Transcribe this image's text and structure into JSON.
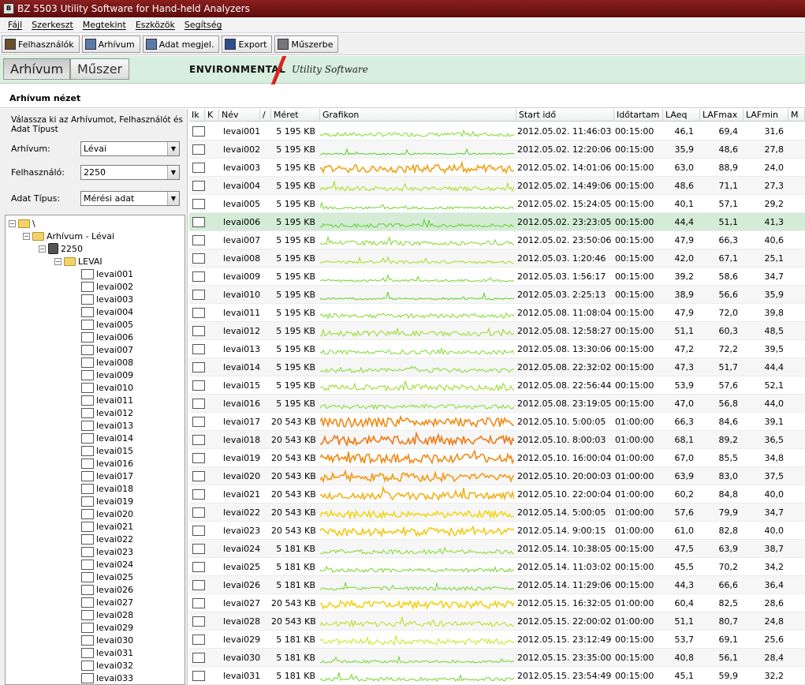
{
  "window": {
    "title": "BZ 5503 Utility Software for Hand-held Analyzers"
  },
  "menu": [
    "Fájl",
    "Szerkeszt",
    "Megtekint",
    "Eszközök",
    "Segítség"
  ],
  "toolbar": {
    "users": "Felhasználók",
    "archive": "Arhívum",
    "view_data": "Adat megjel.",
    "export": "Export",
    "to_device": "Műszerbe"
  },
  "header": {
    "tab_archive": "Arhívum",
    "tab_device": "Műszer",
    "brand": "ENVIRONMENTAL",
    "brand_sub": "Utility Software"
  },
  "section": {
    "title": "Arhívum nézet"
  },
  "left": {
    "instructions": "Válassza ki az Arhívumot, Felhasználót és Adat Típust",
    "archive_label": "Arhívum:",
    "archive_value": "Lévai",
    "user_label": "Felhasználó:",
    "user_value": "2250",
    "type_label": "Adat Típus:",
    "type_value": "Mérési adat"
  },
  "tree": {
    "root": "\\",
    "archive": "Arhívum - Lévai",
    "user": "2250",
    "folder": "LEVAI",
    "items": [
      "levai001",
      "levai002",
      "levai003",
      "levai004",
      "levai005",
      "levai006",
      "levai007",
      "levai008",
      "levai009",
      "levai010",
      "levai011",
      "levai012",
      "levai013",
      "levai014",
      "levai015",
      "levai016",
      "levai017",
      "levai018",
      "levai019",
      "levai020",
      "levai021",
      "levai022",
      "levai023",
      "levai024",
      "levai025",
      "levai026",
      "levai027",
      "levai028",
      "levai029",
      "levai030",
      "levai031",
      "levai032",
      "levai033"
    ]
  },
  "grid": {
    "columns": [
      "Ik",
      "K",
      "Név",
      "/",
      "Méret",
      "Grafikon",
      "Start idő",
      "Időtartam",
      "LAeq",
      "LAFmax",
      "LAFmin",
      "M"
    ],
    "selected_row": 5,
    "rows": [
      {
        "name": "levai001",
        "size": "5 195 KB",
        "start": "2012.05.02. 11:46:03",
        "duration": "00:15:00",
        "laeq": "46,1",
        "lafmax": "69,4",
        "lafmin": "31,6",
        "color": "#7bdc2a"
      },
      {
        "name": "levai002",
        "size": "5 195 KB",
        "start": "2012.05.02. 12:20:06",
        "duration": "00:15:00",
        "laeq": "35,9",
        "lafmax": "48,6",
        "lafmin": "27,8",
        "color": "#4fcf2a"
      },
      {
        "name": "levai003",
        "size": "5 195 KB",
        "start": "2012.05.02. 14:01:06",
        "duration": "00:15:00",
        "laeq": "63,0",
        "lafmax": "88,9",
        "lafmin": "24,0",
        "color": "#f0a21a"
      },
      {
        "name": "levai004",
        "size": "5 195 KB",
        "start": "2012.05.02. 14:49:06",
        "duration": "00:15:00",
        "laeq": "48,6",
        "lafmax": "71,1",
        "lafmin": "27,3",
        "color": "#a5dd1e"
      },
      {
        "name": "levai005",
        "size": "5 195 KB",
        "start": "2012.05.02. 15:24:05",
        "duration": "00:15:00",
        "laeq": "40,1",
        "lafmax": "57,1",
        "lafmin": "29,2",
        "color": "#6fd52a"
      },
      {
        "name": "levai006",
        "size": "5 195 KB",
        "start": "2012.05.02. 23:23:05",
        "duration": "00:15:00",
        "laeq": "44,4",
        "lafmax": "51,1",
        "lafmin": "41,3",
        "color": "#5fd02a"
      },
      {
        "name": "levai007",
        "size": "5 195 KB",
        "start": "2012.05.02. 23:50:06",
        "duration": "00:15:00",
        "laeq": "47,9",
        "lafmax": "66,3",
        "lafmin": "40,6",
        "color": "#7bdc2a"
      },
      {
        "name": "levai008",
        "size": "5 195 KB",
        "start": "2012.05.03. 1:20:46",
        "duration": "00:15:00",
        "laeq": "42,0",
        "lafmax": "67,1",
        "lafmin": "25,1",
        "color": "#a5dd1e"
      },
      {
        "name": "levai009",
        "size": "5 195 KB",
        "start": "2012.05.03. 1:56:17",
        "duration": "00:15:00",
        "laeq": "39,2",
        "lafmax": "58,6",
        "lafmin": "34,7",
        "color": "#6fd52a"
      },
      {
        "name": "levai010",
        "size": "5 195 KB",
        "start": "2012.05.03. 2:25:13",
        "duration": "00:15:00",
        "laeq": "38,9",
        "lafmax": "56,6",
        "lafmin": "35,9",
        "color": "#5fd02a"
      },
      {
        "name": "levai011",
        "size": "5 195 KB",
        "start": "2012.05.08. 11:08:04",
        "duration": "00:15:00",
        "laeq": "47,9",
        "lafmax": "72,0",
        "lafmin": "39,8",
        "color": "#7bdc2a"
      },
      {
        "name": "levai012",
        "size": "5 195 KB",
        "start": "2012.05.08. 12:58:27",
        "duration": "00:15:00",
        "laeq": "51,1",
        "lafmax": "60,3",
        "lafmin": "48,5",
        "color": "#8fdb22"
      },
      {
        "name": "levai013",
        "size": "5 195 KB",
        "start": "2012.05.08. 13:30:06",
        "duration": "00:15:00",
        "laeq": "47,2",
        "lafmax": "72,2",
        "lafmin": "39,5",
        "color": "#7bdc2a"
      },
      {
        "name": "levai014",
        "size": "5 195 KB",
        "start": "2012.05.08. 22:32:02",
        "duration": "00:15:00",
        "laeq": "47,3",
        "lafmax": "51,7",
        "lafmin": "44,4",
        "color": "#7bdc2a"
      },
      {
        "name": "levai015",
        "size": "5 195 KB",
        "start": "2012.05.08. 22:56:44",
        "duration": "00:15:00",
        "laeq": "53,9",
        "lafmax": "57,6",
        "lafmin": "52,1",
        "color": "#8fdb22"
      },
      {
        "name": "levai016",
        "size": "5 195 KB",
        "start": "2012.05.08. 23:19:05",
        "duration": "00:15:00",
        "laeq": "47,0",
        "lafmax": "56,8",
        "lafmin": "44,0",
        "color": "#7bdc2a"
      },
      {
        "name": "levai017",
        "size": "20 543 KB",
        "start": "2012.05.10. 5:00:05",
        "duration": "01:00:00",
        "laeq": "66,3",
        "lafmax": "84,6",
        "lafmin": "39,1",
        "color": "#f08a14"
      },
      {
        "name": "levai018",
        "size": "20 543 KB",
        "start": "2012.05.10. 8:00:03",
        "duration": "01:00:00",
        "laeq": "68,1",
        "lafmax": "89,2",
        "lafmin": "36,5",
        "color": "#f07a14"
      },
      {
        "name": "levai019",
        "size": "20 543 KB",
        "start": "2012.05.10. 16:00:04",
        "duration": "01:00:00",
        "laeq": "67,0",
        "lafmax": "85,5",
        "lafmin": "34,8",
        "color": "#f08a14"
      },
      {
        "name": "levai020",
        "size": "20 543 KB",
        "start": "2012.05.10. 20:00:03",
        "duration": "01:00:00",
        "laeq": "63,9",
        "lafmax": "83,0",
        "lafmin": "37,5",
        "color": "#f29c16"
      },
      {
        "name": "levai021",
        "size": "20 543 KB",
        "start": "2012.05.10. 22:00:04",
        "duration": "01:00:00",
        "laeq": "60,2",
        "lafmax": "84,8",
        "lafmin": "40,0",
        "color": "#f2b01a"
      },
      {
        "name": "levai022",
        "size": "20 543 KB",
        "start": "2012.05.14. 5:00:05",
        "duration": "01:00:00",
        "laeq": "57,6",
        "lafmax": "79,9",
        "lafmin": "34,7",
        "color": "#f2d61a"
      },
      {
        "name": "levai023",
        "size": "20 543 KB",
        "start": "2012.05.14. 9:00:15",
        "duration": "01:00:00",
        "laeq": "61,0",
        "lafmax": "82,8",
        "lafmin": "40,0",
        "color": "#f2c81a"
      },
      {
        "name": "levai024",
        "size": "5 181 KB",
        "start": "2012.05.14. 10:38:05",
        "duration": "00:15:00",
        "laeq": "47,5",
        "lafmax": "63,9",
        "lafmin": "38,7",
        "color": "#7bdc2a"
      },
      {
        "name": "levai025",
        "size": "5 181 KB",
        "start": "2012.05.14. 11:03:02",
        "duration": "00:15:00",
        "laeq": "45,5",
        "lafmax": "70,2",
        "lafmin": "34,2",
        "color": "#6fd52a"
      },
      {
        "name": "levai026",
        "size": "5 181 KB",
        "start": "2012.05.14. 11:29:06",
        "duration": "00:15:00",
        "laeq": "44,3",
        "lafmax": "66,6",
        "lafmin": "36,4",
        "color": "#6fd52a"
      },
      {
        "name": "levai027",
        "size": "20 543 KB",
        "start": "2012.05.15. 16:32:05",
        "duration": "01:00:00",
        "laeq": "60,4",
        "lafmax": "82,5",
        "lafmin": "28,6",
        "color": "#f2d01a"
      },
      {
        "name": "levai028",
        "size": "20 543 KB",
        "start": "2012.05.15. 22:00:02",
        "duration": "01:00:00",
        "laeq": "51,1",
        "lafmax": "80,7",
        "lafmin": "24,8",
        "color": "#b8dc1e"
      },
      {
        "name": "levai029",
        "size": "5 181 KB",
        "start": "2012.05.15. 23:12:49",
        "duration": "00:15:00",
        "laeq": "53,7",
        "lafmax": "69,1",
        "lafmin": "25,6",
        "color": "#c8e41a"
      },
      {
        "name": "levai030",
        "size": "5 181 KB",
        "start": "2012.05.15. 23:35:00",
        "duration": "00:15:00",
        "laeq": "40,8",
        "lafmax": "56,1",
        "lafmin": "28,4",
        "color": "#6fd52a"
      },
      {
        "name": "levai031",
        "size": "5 181 KB",
        "start": "2012.05.15. 23:54:49",
        "duration": "00:15:00",
        "laeq": "45,1",
        "lafmax": "59,9",
        "lafmin": "32,2",
        "color": "#6fd52a"
      }
    ]
  }
}
